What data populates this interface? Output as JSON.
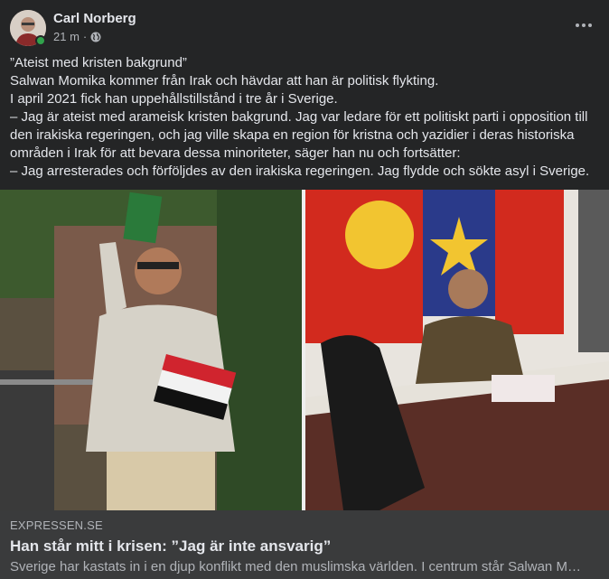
{
  "post": {
    "author": "Carl Norberg",
    "time": "21 m",
    "meta_separator": "·",
    "privacy_icon": "globe-icon",
    "menu_icon": "more-options-icon"
  },
  "body": {
    "lines": [
      "”Ateist med kristen bakgrund”",
      "Salwan Momika kommer från Irak och hävdar att han är politisk flykting.",
      "I april 2021 fick han uppehållstillstånd i tre år i Sverige.",
      "– Jag är ateist med arameisk kristen bakgrund. Jag var ledare för ett politiskt parti i opposition till den irakiska regeringen, och jag ville skapa en region för kristna och yazidier i deras historiska områden i Irak för att bevara dessa minoriteter, säger han nu och fortsätter:",
      "– Jag arresterades och förföljdes av den irakiska regeringen. Jag flydde och sökte asyl i Sverige."
    ]
  },
  "link_preview": {
    "domain": "EXPRESSEN.SE",
    "title": "Han står mitt i krisen: ”Jag är inte ansvarig”",
    "description": "Sverige har kastats in i en djup konflikt med den muslimska världen. I centrum står Salwan Momika"
  },
  "colors": {
    "background": "#242526",
    "card": "#3a3b3c",
    "text_primary": "#e4e6eb",
    "text_secondary": "#b0b3b8",
    "online": "#31a24c"
  }
}
